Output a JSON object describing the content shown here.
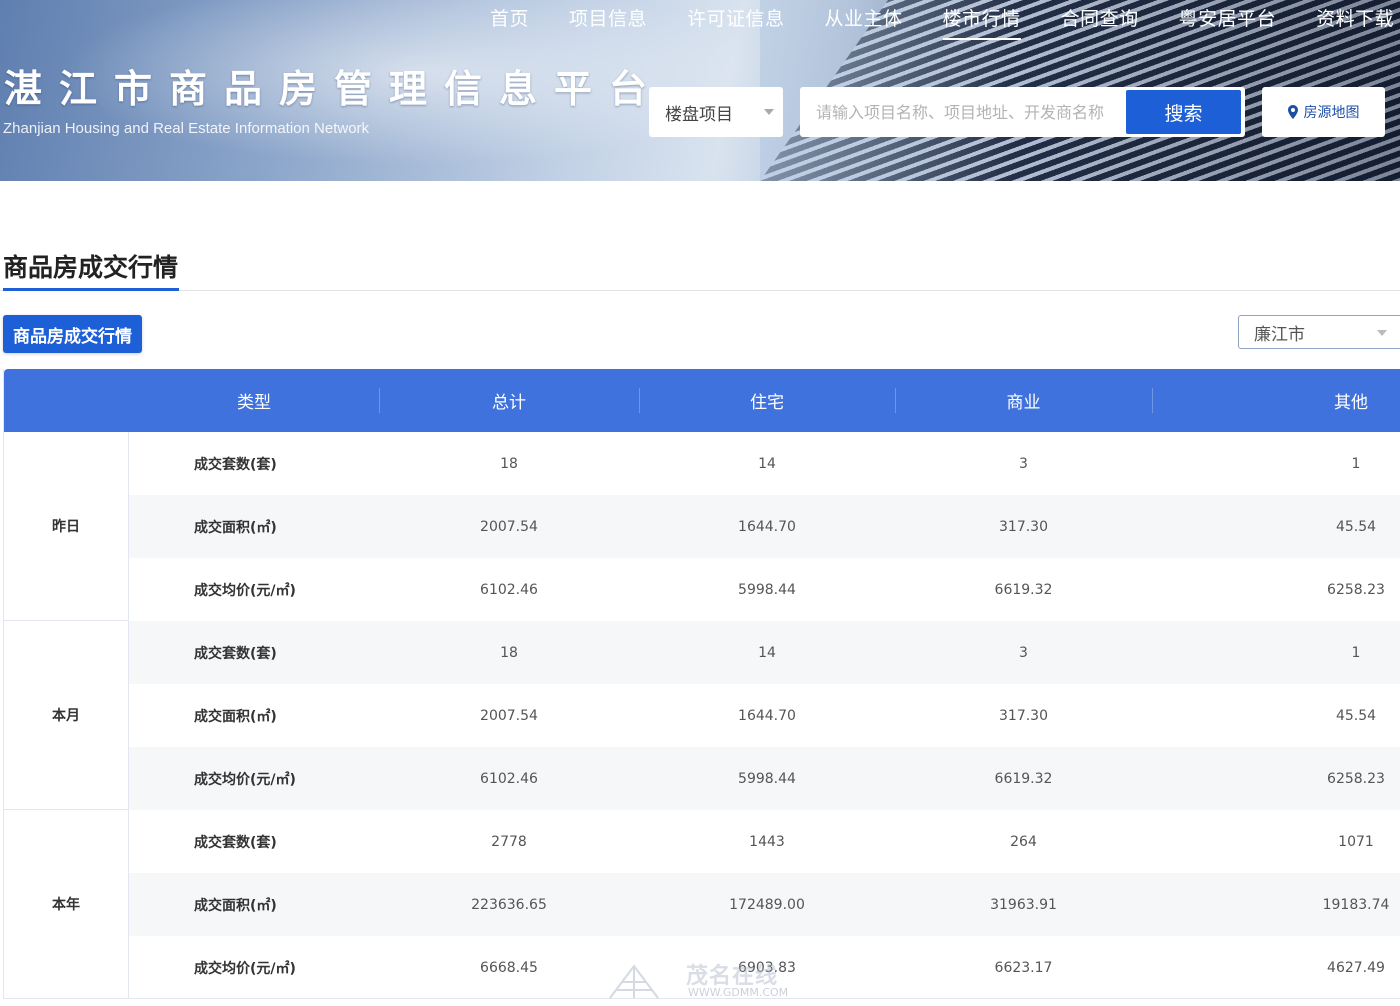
{
  "nav": {
    "items": [
      {
        "label": "首页"
      },
      {
        "label": "项目信息"
      },
      {
        "label": "许可证信息"
      },
      {
        "label": "从业主体"
      },
      {
        "label": "楼市行情",
        "active": true
      },
      {
        "label": "合同查询"
      },
      {
        "label": "粤安居平台"
      },
      {
        "label": "资料下载"
      }
    ]
  },
  "site": {
    "title": "湛江市商品房管理信息平台",
    "subtitle": "Zhanjian Housing and Real Estate Information Network"
  },
  "search": {
    "category_selected": "楼盘项目",
    "placeholder": "请输入项目名称、项目地址、开发商名称",
    "value": "",
    "button_label": "搜索",
    "map_label": "房源地图"
  },
  "section": {
    "title": "商品房成交行情",
    "tab_label": "商品房成交行情",
    "city_selected": "廉江市"
  },
  "table": {
    "headers": [
      "类型",
      "总计",
      "住宅",
      "商业",
      "其他"
    ],
    "groups": [
      {
        "name": "昨日",
        "rows": [
          {
            "label": "成交套数(套)",
            "total": "18",
            "residential": "14",
            "commercial": "3",
            "other": "1"
          },
          {
            "label": "成交面积(㎡)",
            "total": "2007.54",
            "residential": "1644.70",
            "commercial": "317.30",
            "other": "45.54"
          },
          {
            "label": "成交均价(元/㎡)",
            "total": "6102.46",
            "residential": "5998.44",
            "commercial": "6619.32",
            "other": "6258.23"
          }
        ]
      },
      {
        "name": "本月",
        "rows": [
          {
            "label": "成交套数(套)",
            "total": "18",
            "residential": "14",
            "commercial": "3",
            "other": "1"
          },
          {
            "label": "成交面积(㎡)",
            "total": "2007.54",
            "residential": "1644.70",
            "commercial": "317.30",
            "other": "45.54"
          },
          {
            "label": "成交均价(元/㎡)",
            "total": "6102.46",
            "residential": "5998.44",
            "commercial": "6619.32",
            "other": "6258.23"
          }
        ]
      },
      {
        "name": "本年",
        "rows": [
          {
            "label": "成交套数(套)",
            "total": "2778",
            "residential": "1443",
            "commercial": "264",
            "other": "1071"
          },
          {
            "label": "成交面积(㎡)",
            "total": "223636.65",
            "residential": "172489.00",
            "commercial": "31963.91",
            "other": "19183.74"
          },
          {
            "label": "成交均价(元/㎡)",
            "total": "6668.45",
            "residential": "6903.83",
            "commercial": "6623.17",
            "other": "4627.49"
          }
        ]
      }
    ]
  },
  "watermark": {
    "text": "茂名在线",
    "url": "WWW.GDMM.COM"
  },
  "colors": {
    "primary": "#1d5fd6",
    "table_header": "#3f72dc",
    "row_alt": "#f6f7f9"
  },
  "icons": {
    "map": "map-pin-icon",
    "dropdown": "chevron-down-icon"
  }
}
